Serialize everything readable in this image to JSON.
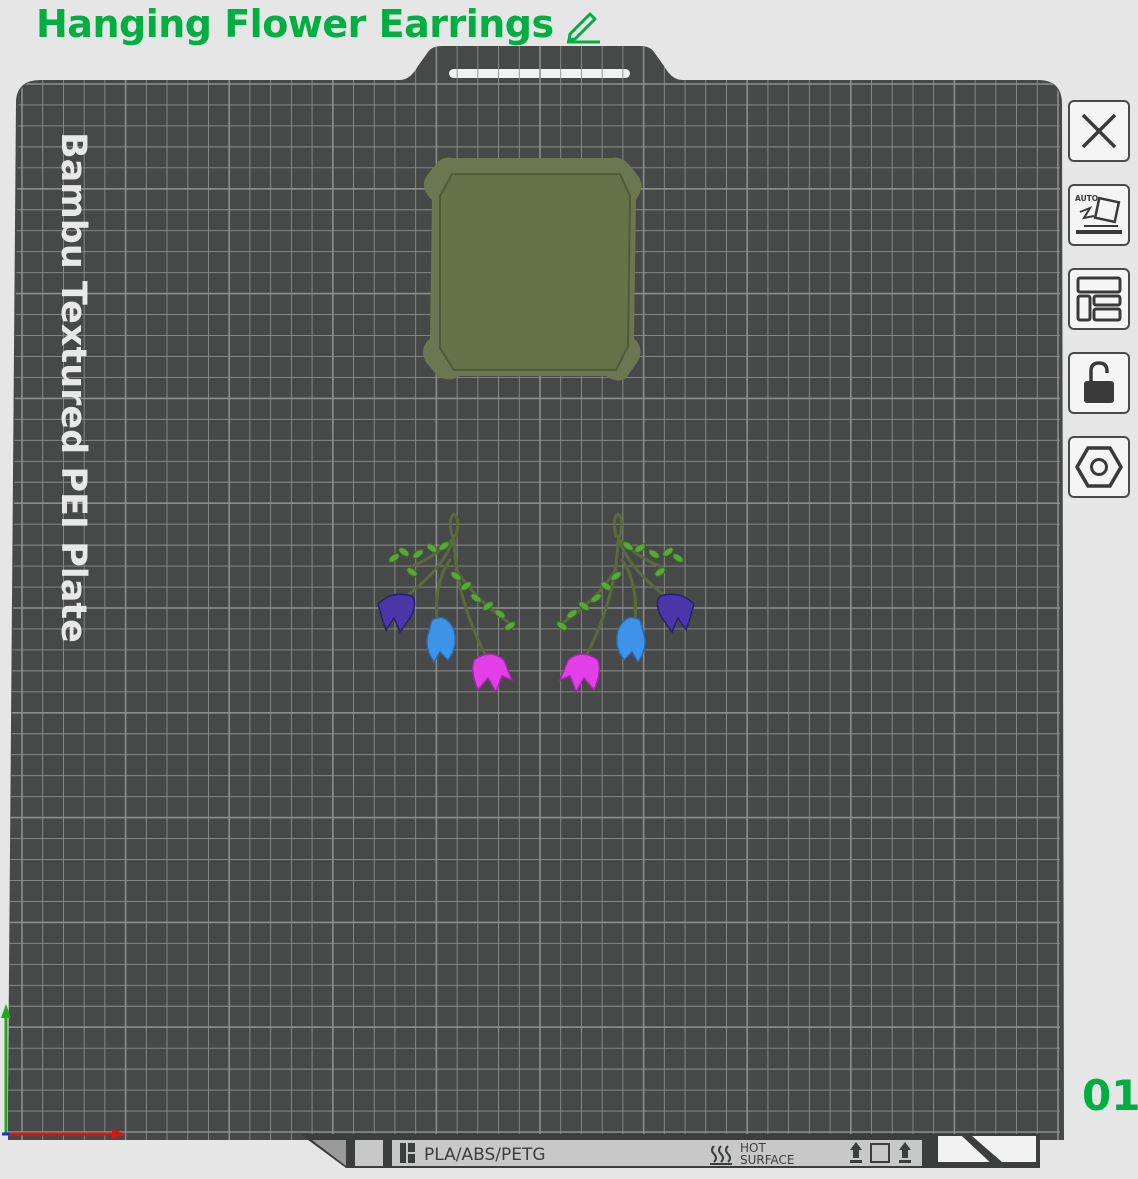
{
  "project": {
    "title": "Hanging Flower Earrings",
    "edit_icon": "pencil-icon"
  },
  "bed": {
    "plate_label": "Bambu Textured PEI Plate",
    "filament_label": "PLA/ABS/PETG",
    "hot_label_line1": "HOT",
    "hot_label_line2": "SURFACE",
    "plate_number": "01"
  },
  "toolbar": {
    "items": [
      {
        "name": "close-plate-button",
        "icon": "close-x-icon"
      },
      {
        "name": "auto-orient-button",
        "icon": "auto-orient-icon",
        "badge": "AUTO"
      },
      {
        "name": "arrange-button",
        "icon": "arrange-layout-icon"
      },
      {
        "name": "lock-plate-button",
        "icon": "unlocked-padlock-icon"
      },
      {
        "name": "plate-settings-button",
        "icon": "hex-nut-settings-icon"
      }
    ]
  },
  "colors": {
    "accent": "#00ae42",
    "bed": "#474848",
    "grid": "#8c8f8f",
    "prime_tower": "#6a7750",
    "flower_purple": "#4b36a8",
    "flower_blue": "#3d93e8",
    "flower_magenta": "#e23fe8",
    "leaf_green": "#5ba53a",
    "stem": "#5a6a3a"
  }
}
